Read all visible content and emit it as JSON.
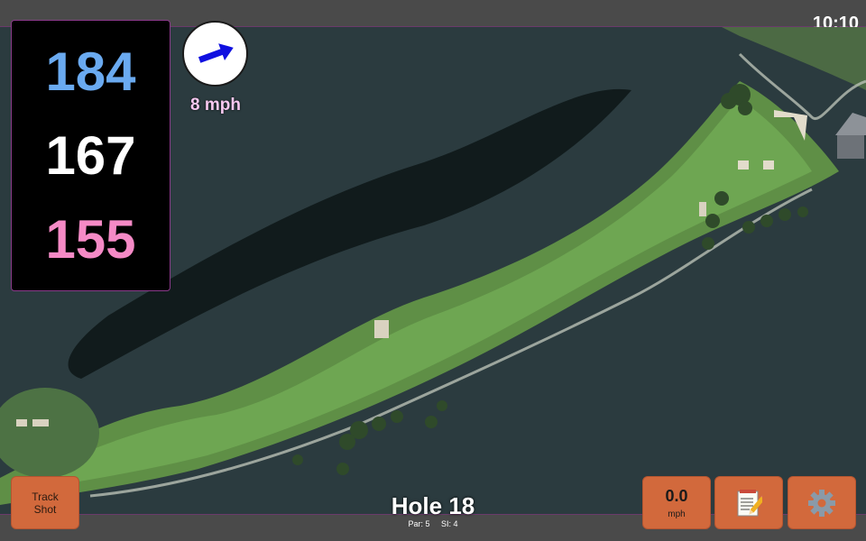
{
  "clock": "10:10",
  "distances": {
    "back": "184",
    "center": "167",
    "front": "155"
  },
  "wind": {
    "speed_text": "8 mph",
    "icon": "wind-arrow-icon",
    "arrow_color": "#1010e0"
  },
  "buttons": {
    "track_shot_label_line1": "Track",
    "track_shot_label_line2": "Shot",
    "speed_value": "0.0",
    "speed_unit": "mph",
    "notes_icon": "notepad-icon",
    "settings_icon": "gear-icon"
  },
  "hole": {
    "title": "Hole 18",
    "par": "Par: 5",
    "si": "SI: 4"
  },
  "colors": {
    "button_bg": "#d2693c",
    "back_distance": "#6aaaf0",
    "front_distance": "#f58ac6",
    "wind_text": "#f7c8f0"
  }
}
